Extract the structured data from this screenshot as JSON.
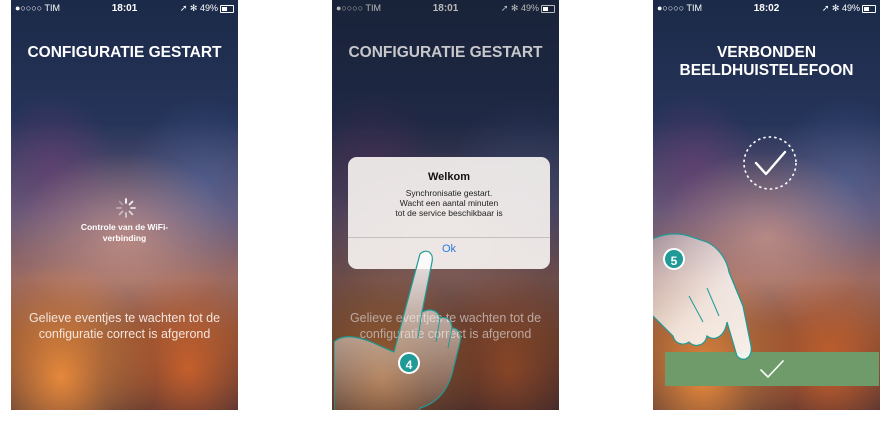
{
  "statusbar": {
    "screen1": {
      "carrier": "●○○○○ TIM",
      "time": "18:01",
      "indicators": "49%"
    },
    "screen2": {
      "carrier": "●○○○○ TIM",
      "time": "18:01",
      "indicators": "49%"
    },
    "screen3": {
      "carrier": "●○○○○ TIM",
      "time": "18:02",
      "indicators": "49%"
    }
  },
  "screen1": {
    "title": "CONFIGURATIE GESTART",
    "loading_text": "Controle van de WiFi-verbinding",
    "wait_text": "Gelieve eventjes te wachten tot de configuratie correct is afgerond"
  },
  "screen2": {
    "title": "CONFIGURATIE GESTART",
    "wait_text": "Gelieve eventjes te wachten tot de configuratie correct is afgerond",
    "dialog": {
      "title": "Welkom",
      "message_line1": "Synchronisatie gestart.",
      "message_line2": "Wacht een aantal minuten",
      "message_line3": "tot de service beschikbaar is",
      "ok_label": "Ok"
    },
    "step_badge": "4"
  },
  "screen3": {
    "title_line1": "VERBONDEN",
    "title_line2": "BEELDHUISTELEFOON",
    "step_badge": "5"
  },
  "colors": {
    "accent_teal": "#1f9a96",
    "ok_blue": "#2a7ae0",
    "confirm_green": "#6f9a6a"
  },
  "icons": [
    "signal-icon",
    "wifi-icon",
    "location-icon",
    "bluetooth-icon",
    "battery-icon",
    "spinner-icon",
    "check-circle-icon",
    "check-icon",
    "hand-pointer-icon"
  ]
}
